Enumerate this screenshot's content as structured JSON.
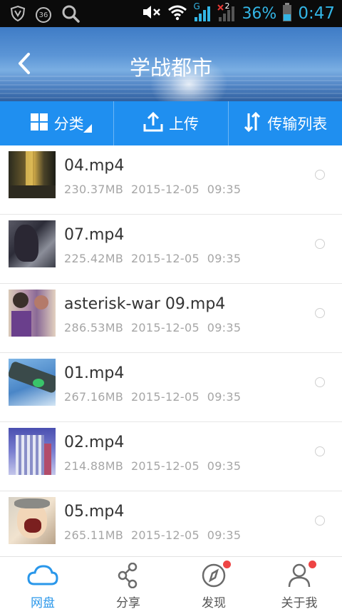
{
  "status_bar": {
    "notification_badge": "36",
    "network_label": "G",
    "sim_label": "2",
    "battery_percent": "36%",
    "time": "0:47",
    "accent_color": "#33b5e5"
  },
  "header": {
    "title": "学战都市",
    "back_icon": "chevron-left-icon"
  },
  "toolbar": {
    "category_label": "分类",
    "upload_label": "上传",
    "transfer_label": "传输列表"
  },
  "files": [
    {
      "name": "04.mp4",
      "size": "230.37MB",
      "date": "2015-12-05",
      "time": "09:35"
    },
    {
      "name": "07.mp4",
      "size": "225.42MB",
      "date": "2015-12-05",
      "time": "09:35"
    },
    {
      "name": "asterisk-war 09.mp4",
      "size": "286.53MB",
      "date": "2015-12-05",
      "time": "09:35"
    },
    {
      "name": "01.mp4",
      "size": "267.16MB",
      "date": "2015-12-05",
      "time": "09:35"
    },
    {
      "name": "02.mp4",
      "size": "214.88MB",
      "date": "2015-12-05",
      "time": "09:35"
    },
    {
      "name": "05.mp4",
      "size": "265.11MB",
      "date": "2015-12-05",
      "time": "09:35"
    }
  ],
  "bottom_nav": {
    "items": [
      {
        "label": "网盘",
        "icon": "cloud-icon",
        "active": true
      },
      {
        "label": "分享",
        "icon": "share-icon",
        "active": false
      },
      {
        "label": "发现",
        "icon": "compass-icon",
        "active": false,
        "badge": true
      },
      {
        "label": "关于我",
        "icon": "user-icon",
        "active": false,
        "badge": true
      }
    ]
  },
  "colors": {
    "toolbar_blue": "#1f8ff0",
    "active_nav": "#2a97ea",
    "badge_red": "#ee4444"
  }
}
